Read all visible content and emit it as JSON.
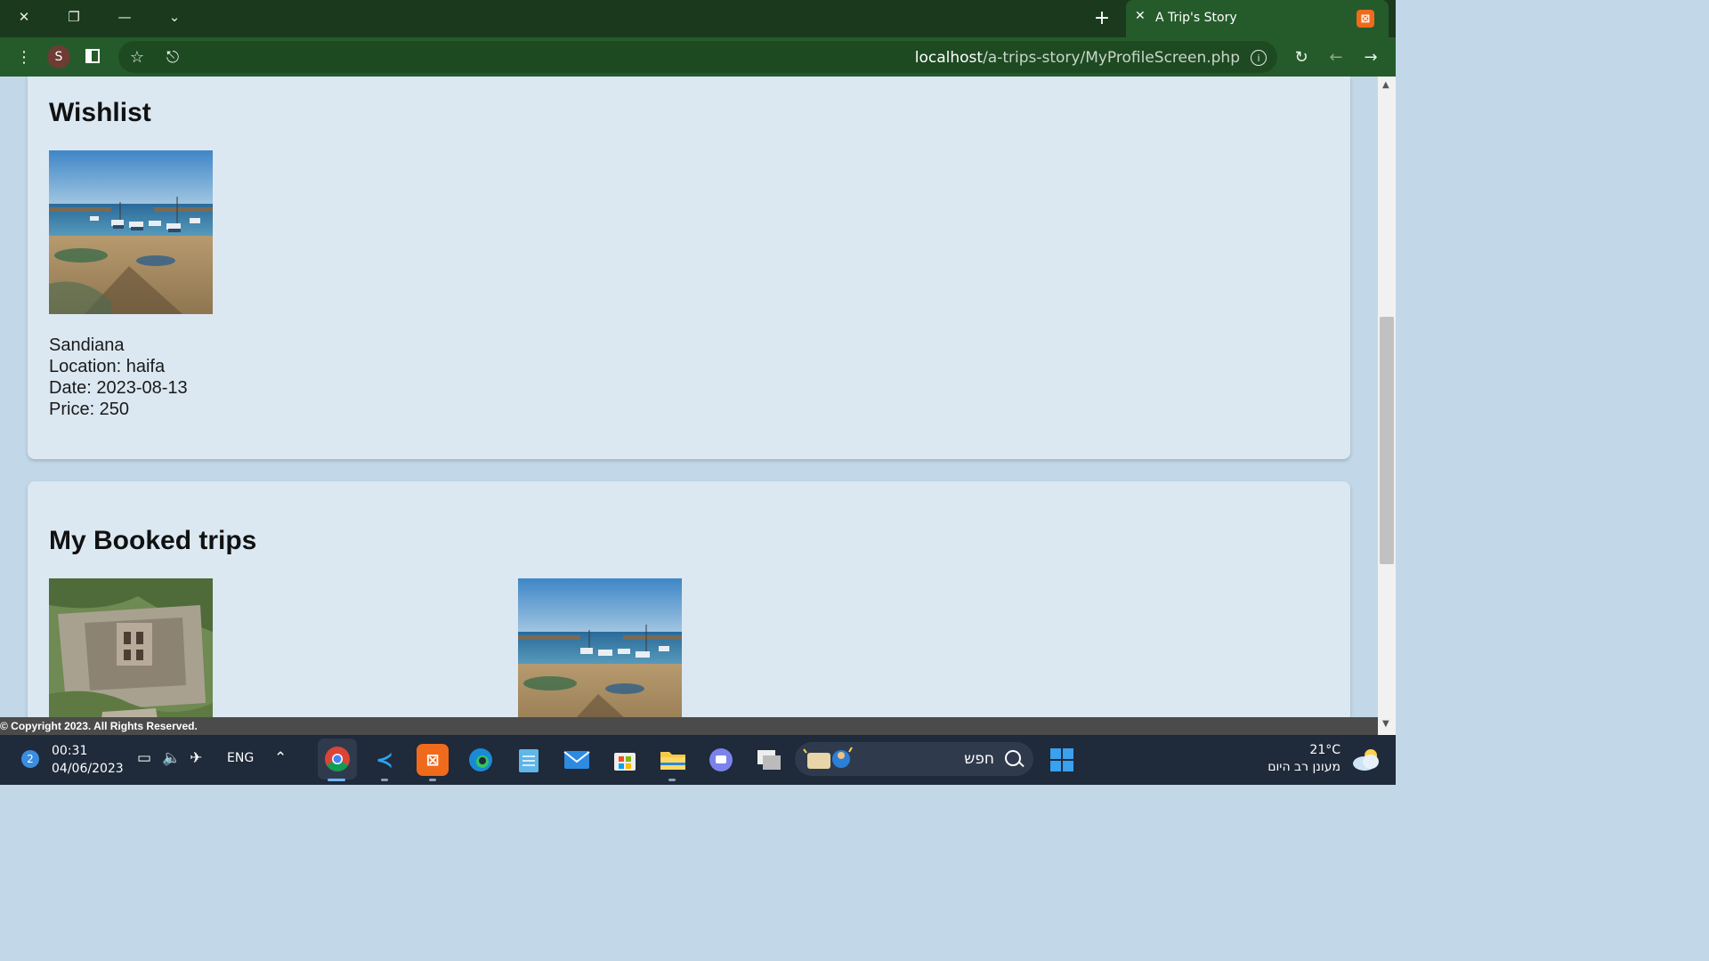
{
  "browser": {
    "tab_title": "A Trip's Story",
    "url_host": "localhost",
    "url_path": "/a-trips-story/MyProfileScreen.php",
    "profile_initial": "S"
  },
  "wishlist": {
    "title": "Wishlist",
    "items": [
      {
        "name": "Sandiana",
        "location": "Location: haifa",
        "date": "Date: 2023-08-13",
        "price": "Price: 250"
      }
    ]
  },
  "booked": {
    "title": "My Booked trips"
  },
  "footer": {
    "copyright": "© Copyright 2023. All Rights Reserved."
  },
  "taskbar": {
    "notifications": "2",
    "time": "00:31",
    "date": "04/06/2023",
    "language": "ENG",
    "search_placeholder": "חפש",
    "temperature": "21°C",
    "weather_text": "מעונן רב היום"
  },
  "colors": {
    "tab_strip": "#1b3a1d",
    "toolbar": "#255b2b",
    "page_bg": "#c2d8e9",
    "card_bg": "#dbe8f2"
  }
}
